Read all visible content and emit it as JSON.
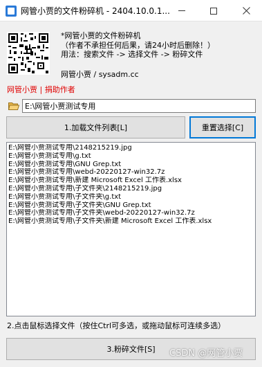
{
  "window": {
    "title": "网管小贾的文件粉碎机 - 2404.10.0.1...",
    "min_icon": "minimize-icon",
    "max_icon": "maximize-icon",
    "close_icon": "close-icon"
  },
  "header": {
    "desc_line1": "*网管小贾的文件粉碎机",
    "desc_line2": "（作者不承担任何后果，请24小时后删除！）",
    "desc_line3": "用法：搜索文件 -> 选择文件 -> 粉碎文件",
    "author": "网管小贾 / sysadm.cc",
    "donate_link": "网管小贾 | 捐助作者",
    "qr_icon": "qr-code-icon"
  },
  "path": {
    "folder_icon": "folder-open-icon",
    "value": "E:\\网管小贾测试专用"
  },
  "buttons": {
    "load": "1.加载文件列表[L]",
    "reset": "重置选择[C]",
    "shred": "3.粉碎文件[S]"
  },
  "files": [
    "E:\\网管小贾测试专用\\2148215219.jpg",
    "E:\\网管小贾测试专用\\g.txt",
    "E:\\网管小贾测试专用\\GNU Grep.txt",
    "E:\\网管小贾测试专用\\webd-20220127-win32.7z",
    "E:\\网管小贾测试专用\\新建 Microsoft Excel 工作表.xlsx",
    "E:\\网管小贾测试专用\\子文件夹\\2148215219.jpg",
    "E:\\网管小贾测试专用\\子文件夹\\g.txt",
    "E:\\网管小贾测试专用\\子文件夹\\GNU Grep.txt",
    "E:\\网管小贾测试专用\\子文件夹\\webd-20220127-win32.7z",
    "E:\\网管小贾测试专用\\子文件夹\\新建 Microsoft Excel 工作表.xlsx"
  ],
  "hint": "2.点击鼠标选择文件（按住Ctrl可多选，或拖动鼠标可连续多选）",
  "watermark": "CSDN @网管小贾",
  "colors": {
    "accent": "#0078d7",
    "link_red": "#e00000",
    "window_bg": "#f0f0f0"
  }
}
